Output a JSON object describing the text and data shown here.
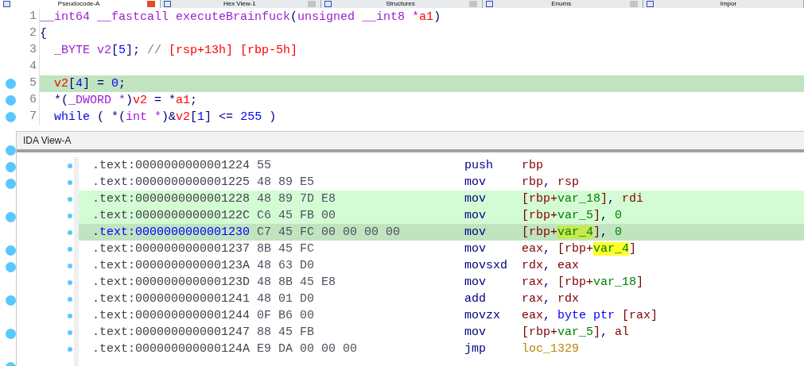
{
  "tabs": [
    {
      "label": "Pseudocode-A",
      "selected": true,
      "closable": true
    },
    {
      "label": "Hex View-1",
      "selected": false,
      "closable": true
    },
    {
      "label": "Structures",
      "selected": false,
      "closable": true
    },
    {
      "label": "Enums",
      "selected": false,
      "closable": true
    },
    {
      "label": "Impor",
      "selected": false,
      "closable": false
    }
  ],
  "pseudocode": {
    "lines": [
      {
        "number": "1",
        "breakpoint": false,
        "selected": false,
        "tokens": [
          {
            "text": "__int64 __fastcall executeBrainfuck",
            "kind": "type"
          },
          {
            "text": "(",
            "kind": "punct"
          },
          {
            "text": "unsigned __int8 *",
            "kind": "type"
          },
          {
            "text": "a1",
            "kind": "var"
          },
          {
            "text": ")",
            "kind": "punct"
          }
        ]
      },
      {
        "number": "2",
        "breakpoint": false,
        "selected": false,
        "tokens": [
          {
            "text": "{",
            "kind": "punct"
          }
        ]
      },
      {
        "number": "3",
        "breakpoint": false,
        "selected": false,
        "tokens": [
          {
            "text": "  _BYTE ",
            "kind": "type"
          },
          {
            "text": "v2",
            "kind": "type"
          },
          {
            "text": "[",
            "kind": "punct"
          },
          {
            "text": "5",
            "kind": "number"
          },
          {
            "text": "]; ",
            "kind": "punct"
          },
          {
            "text": "// ",
            "kind": "comment"
          },
          {
            "text": "[rsp+13h] [rbp-5h]",
            "kind": "var"
          }
        ]
      },
      {
        "number": "4",
        "breakpoint": false,
        "selected": false
      },
      {
        "number": "5",
        "breakpoint": true,
        "selected": true,
        "tokens": [
          {
            "text": "  v2",
            "kind": "var"
          },
          {
            "text": "[",
            "kind": "punct"
          },
          {
            "text": "4",
            "kind": "number"
          },
          {
            "text": "] = ",
            "kind": "punct"
          },
          {
            "text": "0",
            "kind": "number"
          },
          {
            "text": ";",
            "kind": "punct"
          }
        ]
      },
      {
        "number": "6",
        "breakpoint": true,
        "selected": false,
        "tokens": [
          {
            "text": "  *(",
            "kind": "punct"
          },
          {
            "text": "_DWORD *",
            "kind": "type"
          },
          {
            "text": ")",
            "kind": "punct"
          },
          {
            "text": "v2",
            "kind": "var"
          },
          {
            "text": " = *",
            "kind": "punct"
          },
          {
            "text": "a1",
            "kind": "var"
          },
          {
            "text": ";",
            "kind": "punct"
          }
        ]
      },
      {
        "number": "7",
        "breakpoint": true,
        "selected": false,
        "tokens": [
          {
            "text": "  while",
            "kind": "keyword"
          },
          {
            "text": " ( *(",
            "kind": "punct"
          },
          {
            "text": "int *",
            "kind": "type"
          },
          {
            "text": ")&",
            "kind": "punct"
          },
          {
            "text": "v2",
            "kind": "var"
          },
          {
            "text": "[",
            "kind": "punct"
          },
          {
            "text": "1",
            "kind": "number"
          },
          {
            "text": "] <= ",
            "kind": "punct"
          },
          {
            "text": "255",
            "kind": "number"
          },
          {
            "text": " )",
            "kind": "punct"
          }
        ]
      }
    ],
    "covered_lines": [
      {
        "breakpoint": false
      },
      {
        "breakpoint": true
      },
      {
        "breakpoint": true
      },
      {
        "breakpoint": true
      },
      {
        "breakpoint": false
      },
      {
        "breakpoint": true
      },
      {
        "breakpoint": false
      },
      {
        "breakpoint": true
      },
      {
        "breakpoint": true
      },
      {
        "breakpoint": false
      },
      {
        "breakpoint": true
      },
      {
        "breakpoint": false
      },
      {
        "breakpoint": true
      },
      {
        "breakpoint": false
      },
      {
        "breakpoint": true
      }
    ]
  },
  "ida_view": {
    "title": "IDA View-A",
    "rows": [
      {
        "address": ".text:0000000000001224",
        "bytes": "55",
        "mnemonic": "push",
        "highlighted": false,
        "selected": false,
        "operands": [
          {
            "text": "rbp",
            "kind": "reg"
          }
        ]
      },
      {
        "address": ".text:0000000000001225",
        "bytes": "48 89 E5",
        "mnemonic": "mov",
        "highlighted": false,
        "selected": false,
        "operands": [
          {
            "text": "rbp",
            "kind": "reg"
          },
          {
            "text": ", ",
            "kind": "punct"
          },
          {
            "text": "rsp",
            "kind": "reg"
          }
        ]
      },
      {
        "address": ".text:0000000000001228",
        "bytes": "48 89 7D E8",
        "mnemonic": "mov",
        "highlighted": true,
        "selected": false,
        "operands": [
          {
            "text": "[rbp+",
            "kind": "reg"
          },
          {
            "text": "var_18",
            "kind": "var"
          },
          {
            "text": "]",
            "kind": "reg"
          },
          {
            "text": ", ",
            "kind": "punct"
          },
          {
            "text": "rdi",
            "kind": "reg"
          }
        ]
      },
      {
        "address": ".text:000000000000122C",
        "bytes": "C6 45 FB 00",
        "mnemonic": "mov",
        "highlighted": true,
        "selected": false,
        "operands": [
          {
            "text": "[rbp+",
            "kind": "reg"
          },
          {
            "text": "var_5",
            "kind": "var"
          },
          {
            "text": "]",
            "kind": "reg"
          },
          {
            "text": ", ",
            "kind": "punct"
          },
          {
            "text": "0",
            "kind": "var"
          }
        ]
      },
      {
        "address": ".text:0000000000001230",
        "bytes": "C7 45 FC 00 00 00 00",
        "mnemonic": "mov",
        "highlighted": false,
        "selected": true,
        "operands": [
          {
            "text": "[rbp+",
            "kind": "reg"
          },
          {
            "text": "var_4",
            "kind": "var",
            "marked": true
          },
          {
            "text": "]",
            "kind": "reg"
          },
          {
            "text": ", ",
            "kind": "punct"
          },
          {
            "text": "0",
            "kind": "var"
          }
        ]
      },
      {
        "address": ".text:0000000000001237",
        "bytes": "8B 45 FC",
        "mnemonic": "mov",
        "highlighted": false,
        "selected": false,
        "operands": [
          {
            "text": "eax",
            "kind": "reg"
          },
          {
            "text": ", ",
            "kind": "punct"
          },
          {
            "text": "[rbp+",
            "kind": "reg"
          },
          {
            "text": "var_4",
            "kind": "var",
            "marked": true
          },
          {
            "text": "]",
            "kind": "reg"
          }
        ]
      },
      {
        "address": ".text:000000000000123A",
        "bytes": "48 63 D0",
        "mnemonic": "movsxd",
        "highlighted": false,
        "selected": false,
        "operands": [
          {
            "text": "rdx",
            "kind": "reg"
          },
          {
            "text": ", ",
            "kind": "punct"
          },
          {
            "text": "eax",
            "kind": "reg"
          }
        ]
      },
      {
        "address": ".text:000000000000123D",
        "bytes": "48 8B 45 E8",
        "mnemonic": "mov",
        "highlighted": false,
        "selected": false,
        "operands": [
          {
            "text": "rax",
            "kind": "reg"
          },
          {
            "text": ", ",
            "kind": "punct"
          },
          {
            "text": "[rbp+",
            "kind": "reg"
          },
          {
            "text": "var_18",
            "kind": "var"
          },
          {
            "text": "]",
            "kind": "reg"
          }
        ]
      },
      {
        "address": ".text:0000000000001241",
        "bytes": "48 01 D0",
        "mnemonic": "add",
        "highlighted": false,
        "selected": false,
        "operands": [
          {
            "text": "rax",
            "kind": "reg"
          },
          {
            "text": ", ",
            "kind": "punct"
          },
          {
            "text": "rdx",
            "kind": "reg"
          }
        ]
      },
      {
        "address": ".text:0000000000001244",
        "bytes": "0F B6 00",
        "mnemonic": "movzx",
        "highlighted": false,
        "selected": false,
        "operands": [
          {
            "text": "eax",
            "kind": "reg"
          },
          {
            "text": ", ",
            "kind": "punct"
          },
          {
            "text": "byte ptr",
            "kind": "keyword"
          },
          {
            "text": " [rax]",
            "kind": "reg"
          }
        ]
      },
      {
        "address": ".text:0000000000001247",
        "bytes": "88 45 FB",
        "mnemonic": "mov",
        "highlighted": false,
        "selected": false,
        "operands": [
          {
            "text": "[rbp+",
            "kind": "reg"
          },
          {
            "text": "var_5",
            "kind": "var"
          },
          {
            "text": "]",
            "kind": "reg"
          },
          {
            "text": ", ",
            "kind": "punct"
          },
          {
            "text": "al",
            "kind": "reg"
          }
        ]
      },
      {
        "address": ".text:000000000000124A",
        "bytes": "E9 DA 00 00 00",
        "mnemonic": "jmp",
        "highlighted": false,
        "selected": false,
        "operands": [
          {
            "text": "loc_1329",
            "kind": "label"
          }
        ]
      }
    ]
  }
}
